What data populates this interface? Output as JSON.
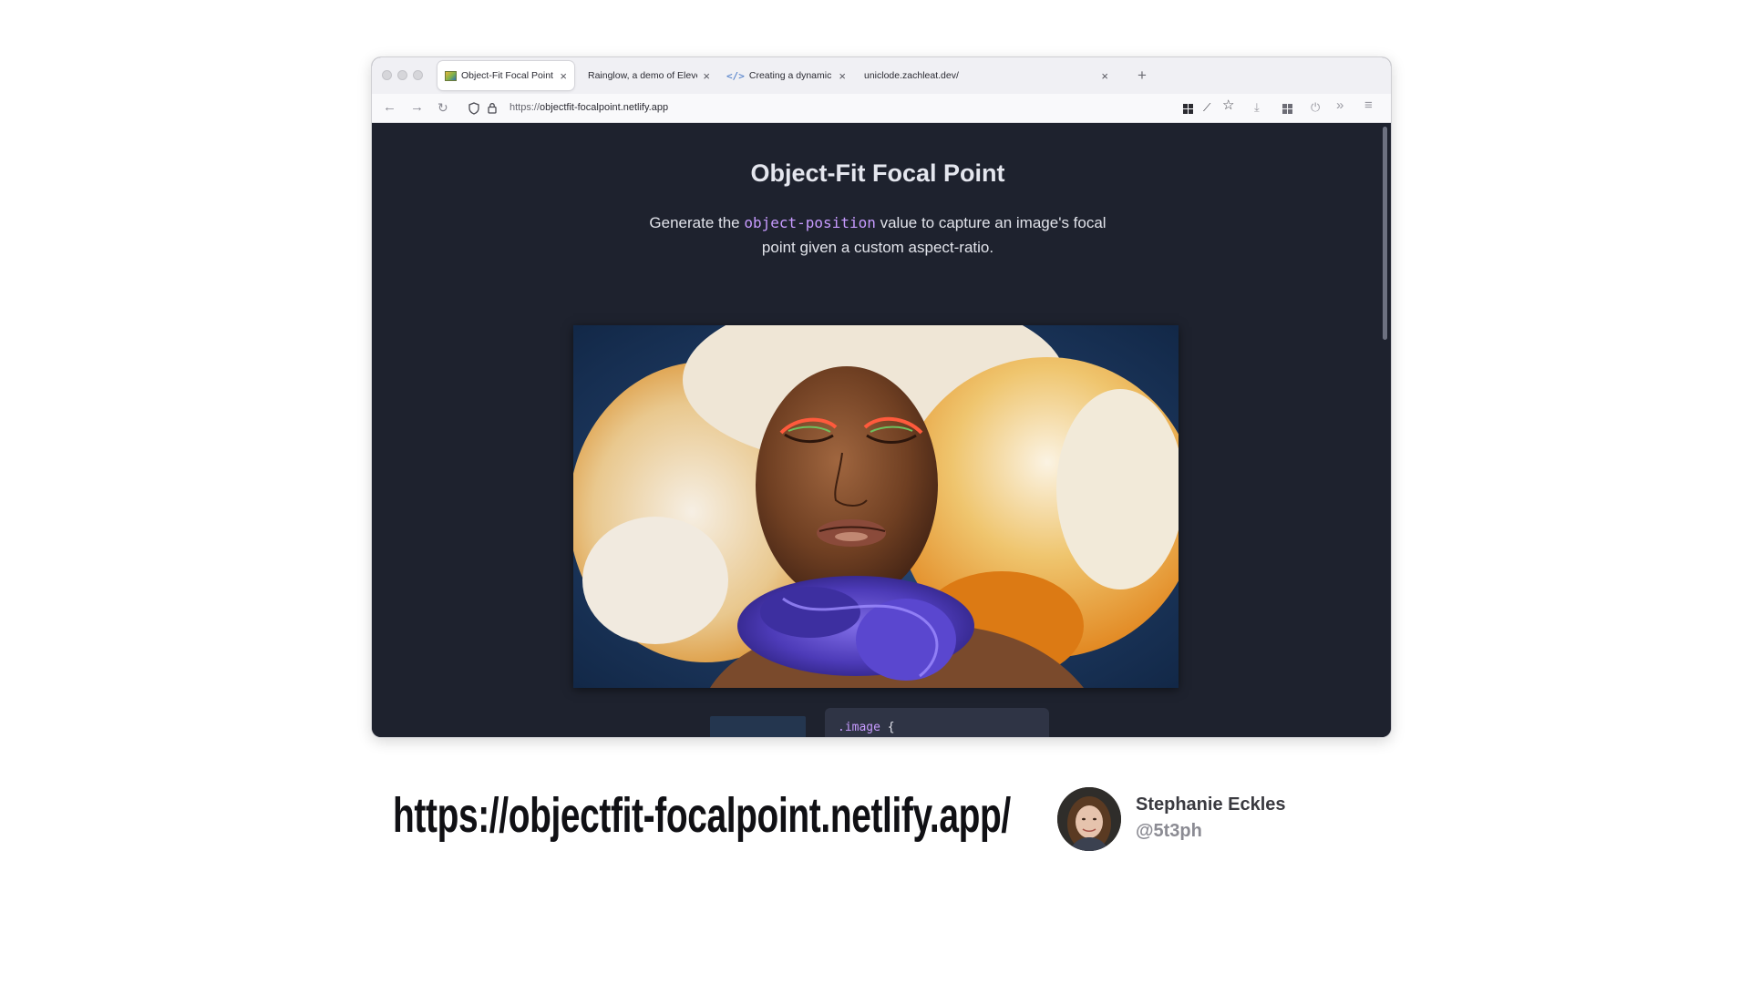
{
  "browser": {
    "tabs": [
      {
        "label": "Object-Fit Focal Point",
        "favicon": "image-frame-icon",
        "active": true
      },
      {
        "label": "Rainglow, a demo of Eleventy Serve",
        "favicon": "",
        "active": false
      },
      {
        "label": "Creating a dynamic color conve",
        "favicon": "code-icon",
        "active": false
      },
      {
        "label": "uniclode.zachleat.dev/",
        "favicon": "",
        "active": false
      }
    ],
    "close_glyph": "×",
    "new_tab_glyph": "+",
    "url": "https://objectfit-focalpoint.netlify.app",
    "url_prefix": "https://",
    "url_host": "objectfit-focalpoint.netlify.app"
  },
  "page": {
    "title": "Object-Fit Focal Point",
    "subtitle_before": "Generate the ",
    "subtitle_code": "object-position",
    "subtitle_after": " value to capture an image's focal point given a custom aspect-ratio.",
    "code_selector": ".image",
    "code_brace": "{",
    "background": "#1e222e",
    "accent": "#c79bff"
  },
  "slide": {
    "url": "https://objectfit-focalpoint.netlify.app/",
    "author_name": "Stephanie Eckles",
    "author_handle": "@5t3ph"
  }
}
